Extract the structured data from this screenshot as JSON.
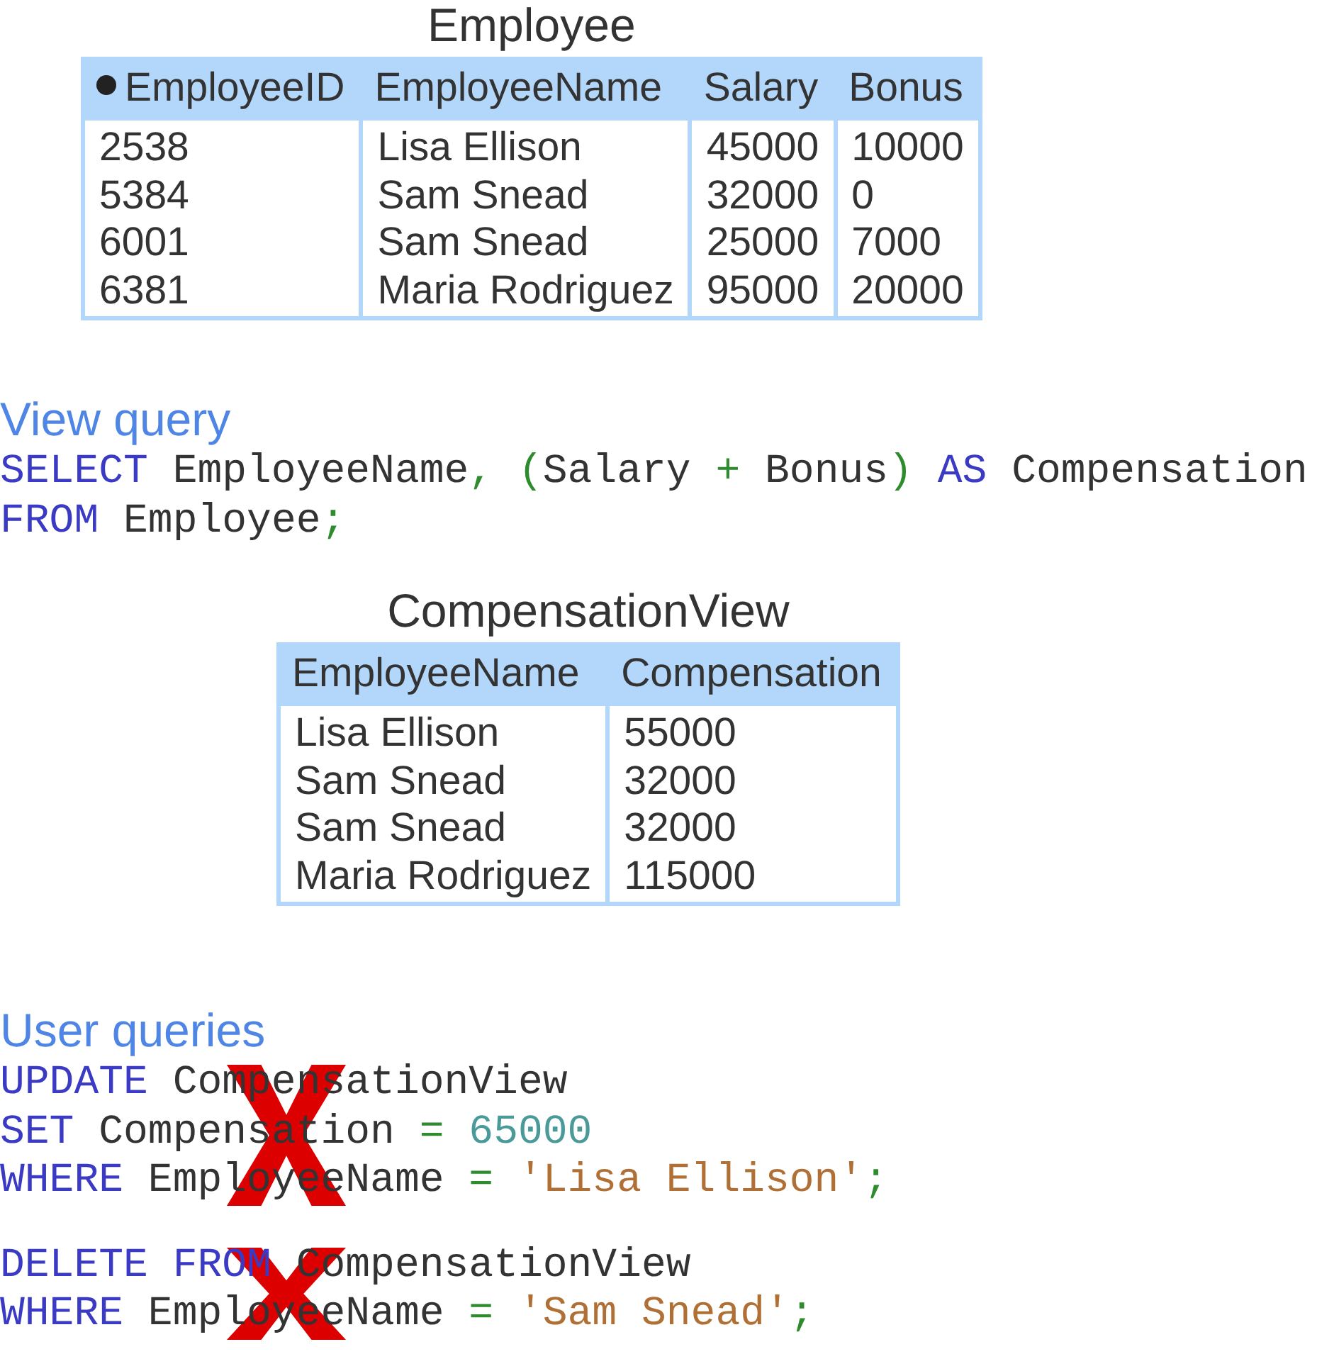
{
  "tables": [
    {
      "title": "Employee",
      "columns": [
        {
          "header": "EmployeeID",
          "key": true,
          "values": [
            "2538",
            "5384",
            "6001",
            "6381"
          ]
        },
        {
          "header": "EmployeeName",
          "values": [
            "Lisa Ellison",
            "Sam Snead",
            "Sam Snead",
            "Maria Rodriguez"
          ]
        },
        {
          "header": "Salary",
          "values": [
            "45000",
            "32000",
            "25000",
            "95000"
          ]
        },
        {
          "header": "Bonus",
          "values": [
            "10000",
            "0",
            "7000",
            "20000"
          ]
        }
      ]
    }
  ],
  "view_query": {
    "heading": "View query",
    "lines": [
      [
        {
          "kind": "keyword",
          "text": "SELECT"
        },
        {
          "kind": "plain",
          "text": " EmployeeName"
        },
        {
          "kind": "punct",
          "text": ", ("
        },
        {
          "kind": "plain",
          "text": "Salary "
        },
        {
          "kind": "punct",
          "text": "+"
        },
        {
          "kind": "plain",
          "text": " Bonus"
        },
        {
          "kind": "punct",
          "text": ") "
        },
        {
          "kind": "keyword",
          "text": "AS"
        },
        {
          "kind": "plain",
          "text": " Compensation"
        }
      ],
      [
        {
          "kind": "keyword",
          "text": "FROM"
        },
        {
          "kind": "plain",
          "text": " Employee"
        },
        {
          "kind": "punct",
          "text": ";"
        }
      ]
    ]
  },
  "view_table": {
    "title": "CompensationView",
    "columns": [
      {
        "header": "EmployeeName",
        "values": [
          "Lisa Ellison",
          "Sam Snead",
          "Sam Snead",
          "Maria Rodriguez"
        ]
      },
      {
        "header": "Compensation",
        "values": [
          "55000",
          "32000",
          "32000",
          "115000"
        ]
      }
    ]
  },
  "user_queries": {
    "heading": "User queries",
    "queries": [
      {
        "rejected": true,
        "lines": [
          [
            {
              "kind": "keyword",
              "text": "UPDATE"
            },
            {
              "kind": "plain",
              "text": " CompensationView"
            }
          ],
          [
            {
              "kind": "keyword",
              "text": "SET"
            },
            {
              "kind": "plain",
              "text": " Compensation "
            },
            {
              "kind": "punct",
              "text": "= "
            },
            {
              "kind": "number",
              "text": "65000"
            }
          ],
          [
            {
              "kind": "keyword",
              "text": "WHERE"
            },
            {
              "kind": "plain",
              "text": " EmployeeName "
            },
            {
              "kind": "punct",
              "text": "= "
            },
            {
              "kind": "string",
              "text": "'Lisa Ellison'"
            },
            {
              "kind": "punct",
              "text": ";"
            }
          ]
        ]
      },
      {
        "rejected": true,
        "lines": [
          [
            {
              "kind": "keyword",
              "text": "DELETE FROM"
            },
            {
              "kind": "plain",
              "text": " CompensationView"
            }
          ],
          [
            {
              "kind": "keyword",
              "text": "WHERE"
            },
            {
              "kind": "plain",
              "text": " EmployeeName "
            },
            {
              "kind": "punct",
              "text": "= "
            },
            {
              "kind": "string",
              "text": "'Sam Snead'"
            },
            {
              "kind": "punct",
              "text": ";"
            }
          ]
        ]
      }
    ]
  }
}
